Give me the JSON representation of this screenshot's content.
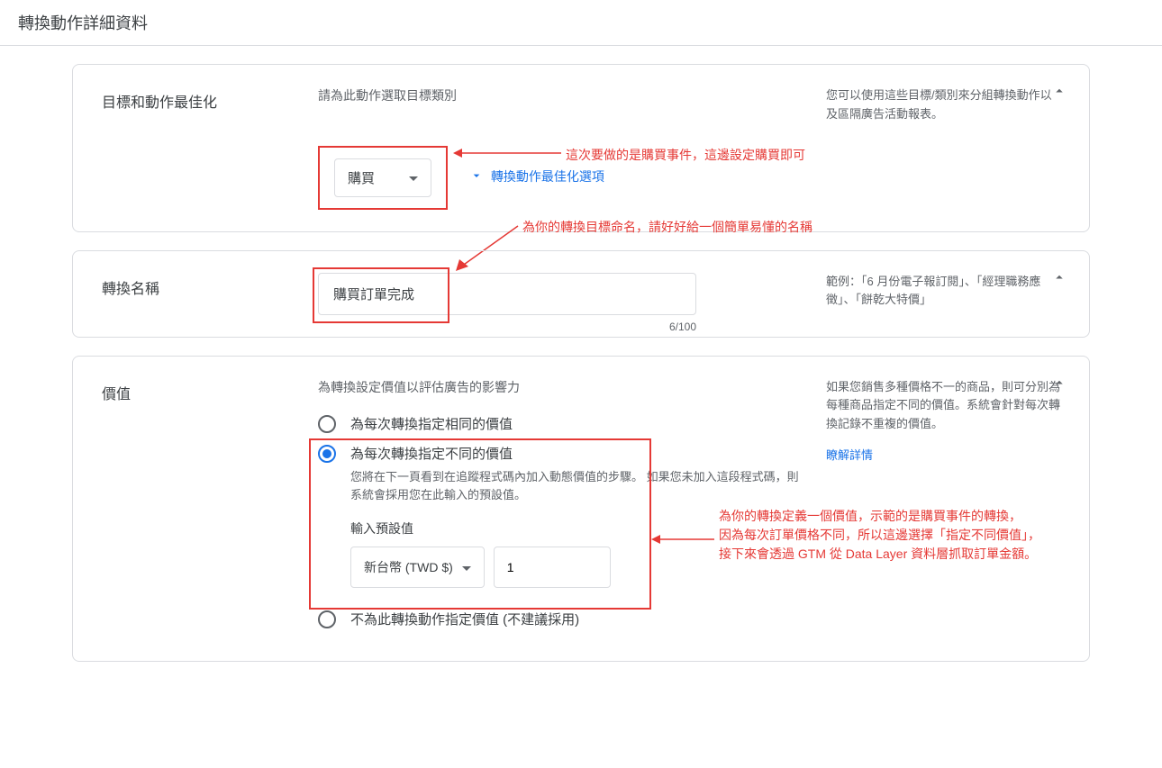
{
  "pageTitle": "轉換動作詳細資料",
  "section1": {
    "label": "目標和動作最佳化",
    "subtitle": "請為此動作選取目標類別",
    "selectValue": "購買",
    "expandLabel": "轉換動作最佳化選項",
    "sideText": "您可以使用這些目標/類別來分組轉換動作以及區隔廣告活動報表。",
    "annotation": "這次要做的是購買事件，這邊設定購買即可"
  },
  "section2": {
    "label": "轉換名稱",
    "inputValue": "購買訂單完成",
    "charCount": "6/100",
    "sideText": "範例：「6 月份電子報訂閱」、「經理職務應徵」、「餅乾大特價」",
    "annotation": "為你的轉換目標命名，請好好給一個簡單易懂的名稱"
  },
  "section3": {
    "label": "價值",
    "subtitle": "為轉換設定價值以評估廣告的影響力",
    "radio1Label": "為每次轉換指定相同的價值",
    "radio2Label": "為每次轉換指定不同的價值",
    "radio2Sub": "您將在下一頁看到在追蹤程式碼內加入動態價值的步驟。 如果您未加入這段程式碼，則系統會採用您在此輸入的預設值。",
    "defaultLabel": "輸入預設值",
    "currency": "新台幣 (TWD $)",
    "defaultValue": "1",
    "radio3Label": "不為此轉換動作指定價值 (不建議採用)",
    "sideText": "如果您銷售多種價格不一的商品，則可分別為每種商品指定不同的價值。系統會針對每次轉換記錄不重複的價值。",
    "sideLink": "瞭解詳情",
    "annoLine1": "為你的轉換定義一個價值，示範的是購買事件的轉換，",
    "annoLine2": "因為每次訂單價格不同，所以這邊選擇「指定不同價值」，",
    "annoLine3": "接下來會透過 GTM 從 Data Layer 資料層抓取訂單金額。"
  }
}
